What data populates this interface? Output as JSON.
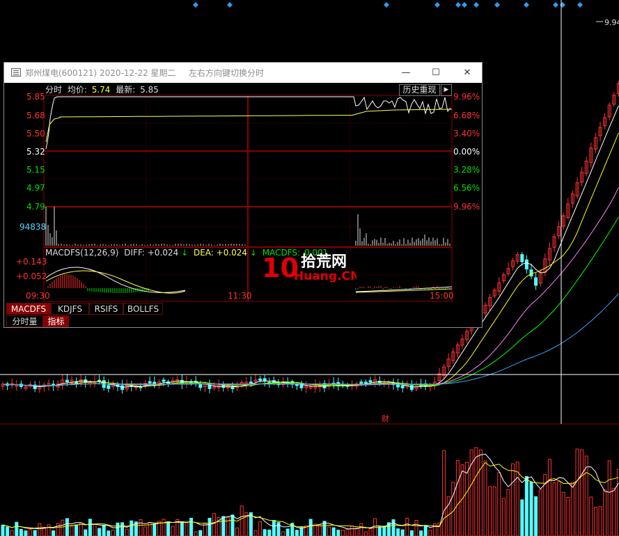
{
  "background_chart": {
    "price_top_label": "9.94",
    "marker_label": "财",
    "colors": {
      "up": "#ff3232",
      "down": "#54ffff",
      "ma5": "#ffffff",
      "ma10": "#ffff00",
      "ma20": "#ff80ff",
      "ma30": "#00ff00",
      "ma60": "#40a0ff"
    }
  },
  "popup": {
    "title": "郑州煤电(600121) 2020-12-22 星期二",
    "hint": "左右方向键切换分时",
    "window_buttons": {
      "minimize": "—",
      "maximize": "☐",
      "close": "✕"
    },
    "history_replay_label": "历史重现",
    "history_arrow": "▶",
    "minute_chart": {
      "header_prefix": "分时",
      "avg_label": "均价:",
      "avg_value": "5.74",
      "latest_label": "最新:",
      "latest_value": "5.85",
      "left_ticks": [
        "5.85",
        "5.68",
        "5.50",
        "5.32",
        "5.15",
        "4.97",
        "4.79"
      ],
      "right_ticks": [
        "9.96%",
        "6.68%",
        "3.40%",
        "0.00%",
        "3.28%",
        "6.56%",
        "9.96%"
      ],
      "volume_label": "94838",
      "time_labels": [
        "09:30",
        "11:30",
        "15:00"
      ]
    },
    "macd": {
      "header": "MACDFS(12,26,9)",
      "diff_label": "DIFF:",
      "diff_value": "+0.024",
      "dea_label": "DEA:",
      "dea_value": "+0.024",
      "macd_label": "MACDFS:",
      "macd_value": "0.001",
      "ticks": [
        "+0.143",
        "+0.052"
      ]
    },
    "indicator_tabs": [
      "MACDFS",
      "KDJFS",
      "RSIFS",
      "BOLLFS"
    ],
    "bottom_tabs": [
      "分时量",
      "指标"
    ]
  },
  "watermark": {
    "number": "10",
    "cn": "拾荒网",
    "en": "Huang.CN"
  }
}
